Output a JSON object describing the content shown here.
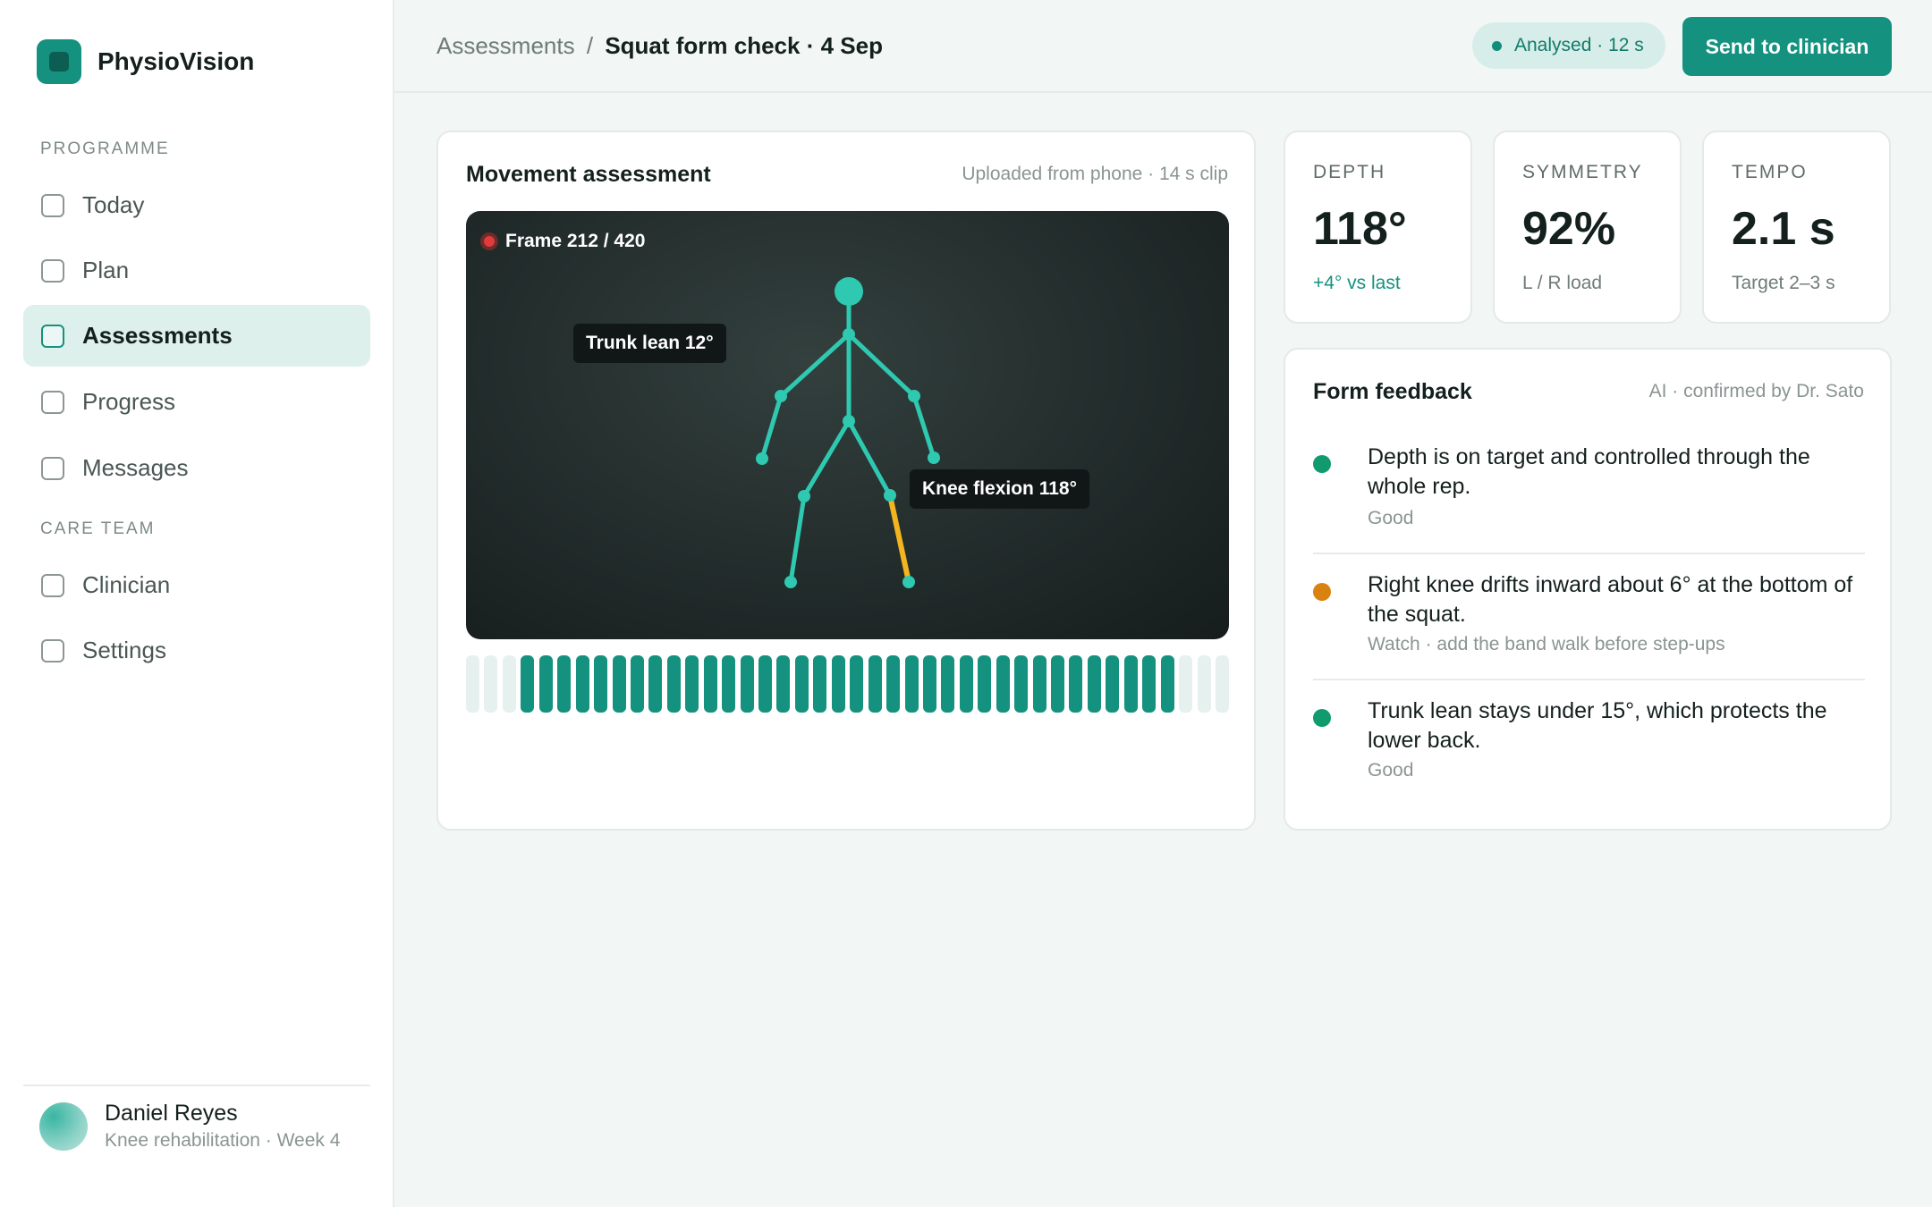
{
  "app": {
    "name": "PhysioVision"
  },
  "sidebar": {
    "sections": [
      {
        "label": "PROGRAMME",
        "items": [
          "Today",
          "Plan",
          "Assessments",
          "Progress",
          "Messages"
        ]
      },
      {
        "label": "CARE TEAM",
        "items": [
          "Clinician",
          "Settings"
        ]
      }
    ],
    "active_item": "Assessments"
  },
  "user": {
    "name": "Daniel Reyes",
    "subtitle": "Knee rehabilitation · Week 4"
  },
  "header": {
    "breadcrumb_parent": "Assessments",
    "breadcrumb_separator": "/",
    "breadcrumb_current": "Squat form check · 4 Sep",
    "status": "Analysed · 12 s",
    "send_button": "Send to clinician"
  },
  "movement": {
    "title": "Movement assessment",
    "meta": "Uploaded from phone · 14 s clip",
    "frame_label": "Frame 212 / 420",
    "trunk_tag": "Trunk lean 12°",
    "knee_tag": "Knee flexion 118°",
    "timeline": {
      "total_segments": 42,
      "processed_start": 3,
      "processed_end": 39
    }
  },
  "metrics": [
    {
      "label": "DEPTH",
      "value": "118°",
      "sub": "+4° vs last",
      "positive": true
    },
    {
      "label": "SYMMETRY",
      "value": "92%",
      "sub": "L / R load",
      "positive": false
    },
    {
      "label": "TEMPO",
      "value": "2.1 s",
      "sub": "Target 2–3 s",
      "positive": false
    }
  ],
  "feedback": {
    "title": "Form feedback",
    "meta": "AI · confirmed by Dr. Sato",
    "items": [
      {
        "text": "Depth is on target and controlled through the whole rep.",
        "status": "Good",
        "color": "#0f9b6e"
      },
      {
        "text": "Right knee drifts inward about 6° at the bottom of the squat.",
        "status": "Watch · add the band walk before step-ups",
        "color": "#d9820f"
      },
      {
        "text": "Trunk lean stays under 15°, which protects the lower back.",
        "status": "Good",
        "color": "#0f9b6e"
      }
    ]
  },
  "colors": {
    "accent": "#14917f",
    "skeleton": "#2ec9b0",
    "highlight_segment": "#f2b51f",
    "timeline_active": "#14917f",
    "timeline_inactive": "#e6f0ee"
  }
}
